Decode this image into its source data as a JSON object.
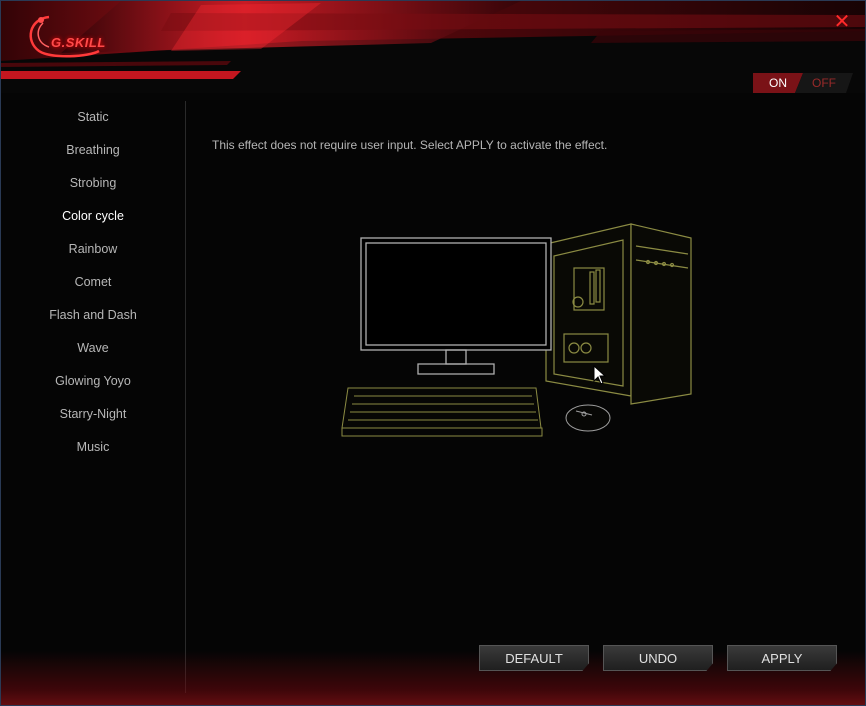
{
  "app": {
    "logo_text": "G.SKILL"
  },
  "power": {
    "on_label": "ON",
    "off_label": "OFF",
    "state": "on"
  },
  "sidebar": {
    "items": [
      {
        "label": "Static"
      },
      {
        "label": "Breathing"
      },
      {
        "label": "Strobing"
      },
      {
        "label": "Color cycle",
        "active": true
      },
      {
        "label": "Rainbow"
      },
      {
        "label": "Comet"
      },
      {
        "label": "Flash and Dash"
      },
      {
        "label": "Wave"
      },
      {
        "label": "Glowing Yoyo"
      },
      {
        "label": "Starry-Night"
      },
      {
        "label": "Music"
      }
    ]
  },
  "main": {
    "description": "This effect does not require user input. Select APPLY to activate the effect."
  },
  "buttons": {
    "default_label": "DEFAULT",
    "undo_label": "UNDO",
    "apply_label": "APPLY"
  },
  "colors": {
    "accent": "#c0141c",
    "line_art": "#9a9a4a"
  }
}
